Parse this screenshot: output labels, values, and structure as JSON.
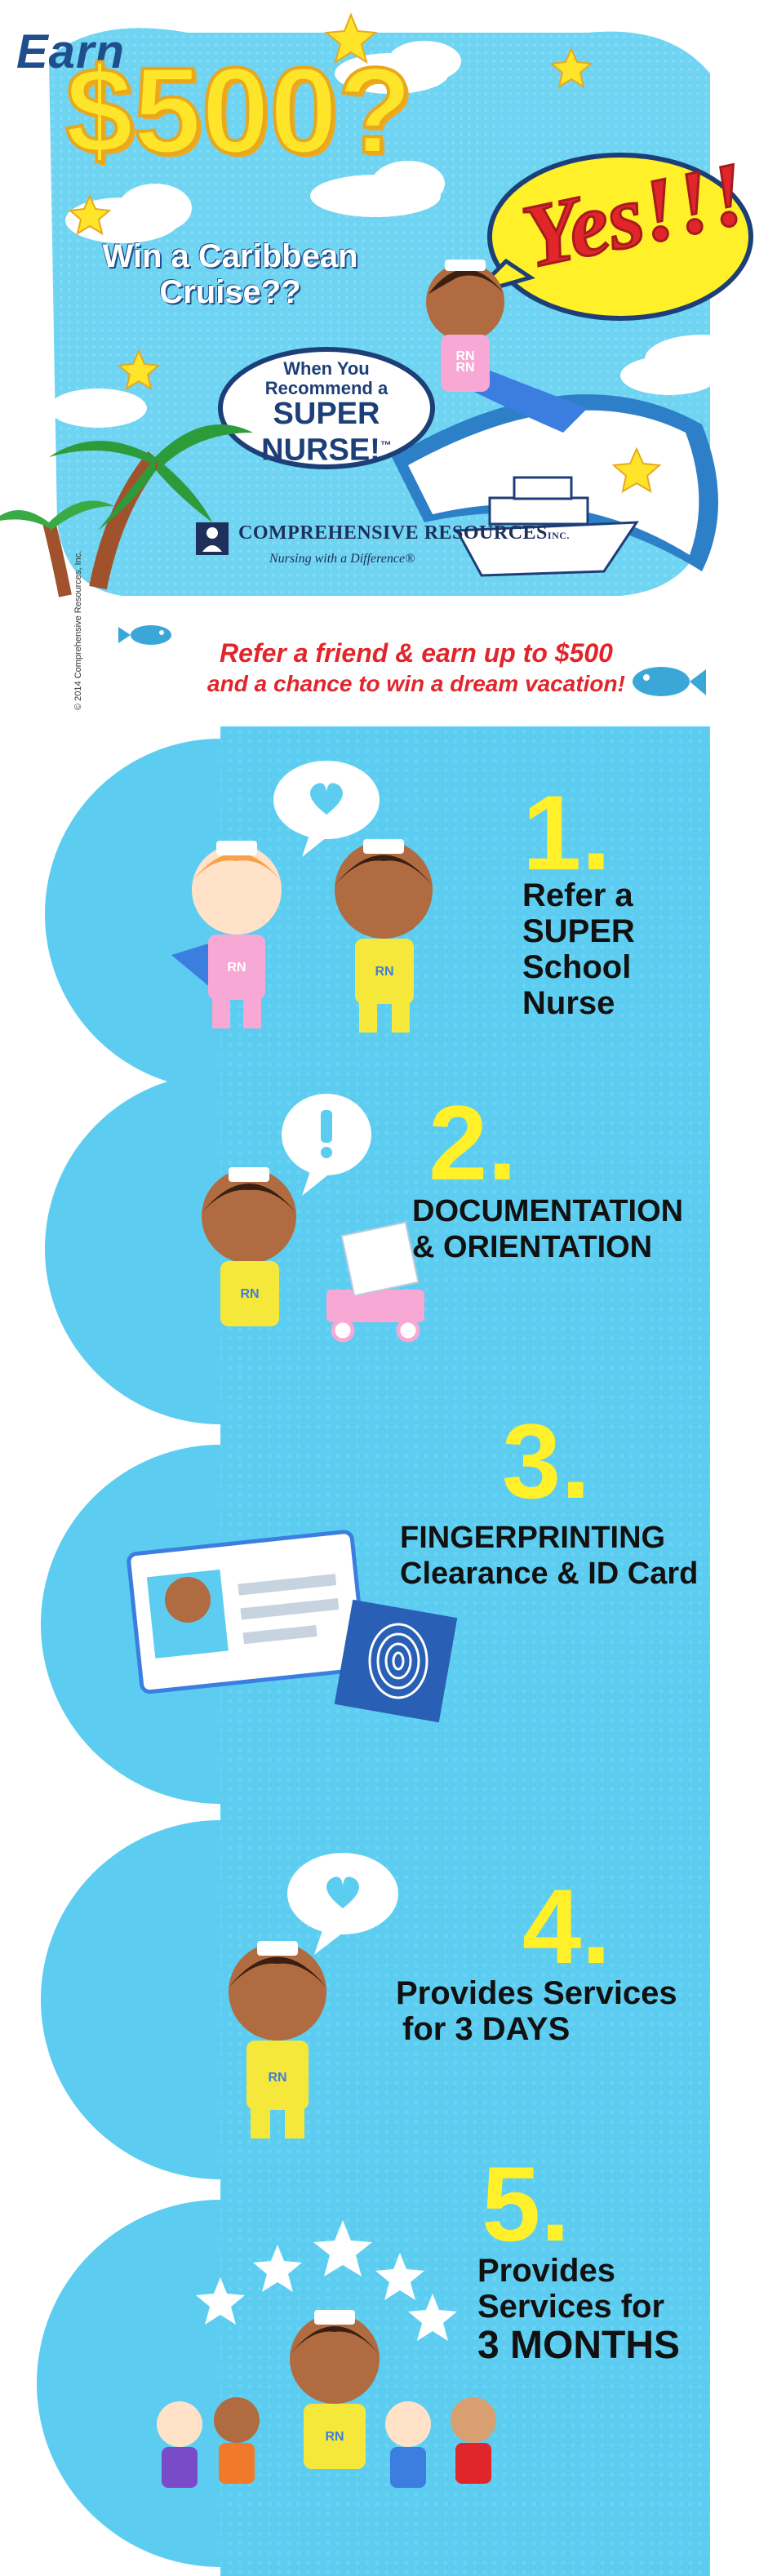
{
  "hero": {
    "earn": "Earn",
    "amount": "$500?",
    "subtitle_line1": "Win a Caribbean",
    "subtitle_line2": "Cruise??",
    "yes": "Yes!!!",
    "oval_line1": "When You",
    "oval_line2": "Recommend a",
    "oval_line3": "SUPER",
    "oval_line4": "NURSE!",
    "oval_tm": "™",
    "badge_rn": "RN",
    "logo_name": "COMPREHENSIVE RESOURCES",
    "logo_inc": "INC.",
    "logo_tagline": "Nursing with a Difference®",
    "copyright": "© 2014 Comprehensive Resources, Inc."
  },
  "banner": {
    "line1": "Refer a friend & earn up to $500",
    "line2": "and a chance to win a dream vacation!"
  },
  "steps": [
    {
      "number": "1.",
      "lines": [
        "Refer a",
        "SUPER",
        "School",
        "Nurse"
      ]
    },
    {
      "number": "2.",
      "lines": [
        "DOCUMENTATION",
        "& ORIENTATION"
      ]
    },
    {
      "number": "3.",
      "lines": [
        "FINGERPRINTING",
        "Clearance & ID Card"
      ]
    },
    {
      "number": "4.",
      "lines": [
        "Provides Services",
        "for 3 DAYS"
      ]
    },
    {
      "number": "5.",
      "lines": [
        "Provides",
        "Services for",
        "3 MONTHS"
      ]
    }
  ],
  "colors": {
    "sky": "#6fd3f2",
    "panel": "#5ccdf0",
    "yellow": "#fff02a",
    "red": "#e1262b",
    "navy": "#1d3f78",
    "pink": "#f7a8d4"
  },
  "icons": [
    "star-icon",
    "heart-icon",
    "exclamation-icon",
    "fish-icon",
    "palm-tree-icon",
    "cruise-ship-icon",
    "fingerprint-icon",
    "id-card-icon",
    "wagon-icon",
    "stethoscope-icon"
  ]
}
